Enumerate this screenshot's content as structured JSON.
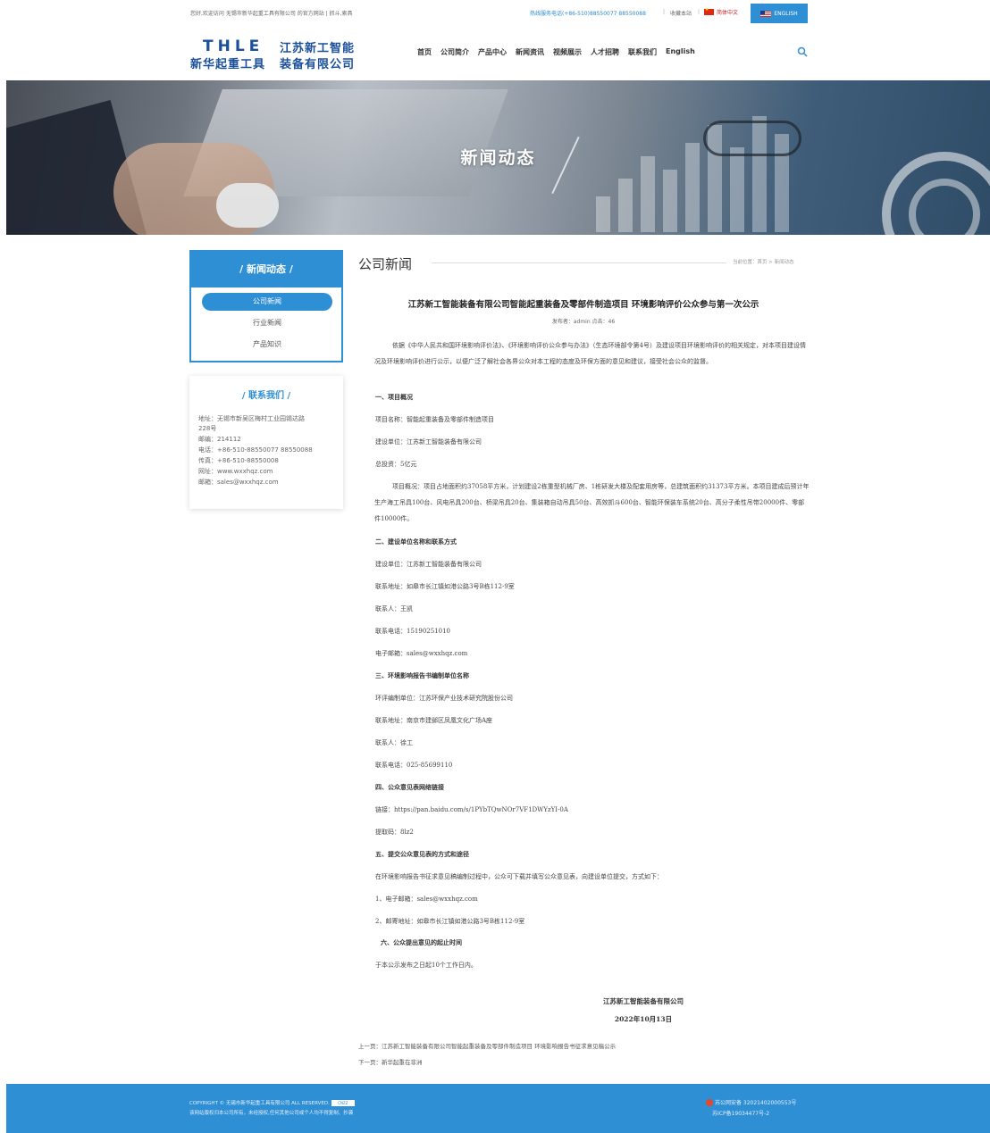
{
  "topbar": {
    "welcome": "您好,欢迎访问 无锡市新华起重工具有限公司 的官方网站  |  抓斗,索具",
    "hotline": "热线服务电话(+86-510)88550077 88550088",
    "bookmark": "收藏本站",
    "lang_cn": "简体中文",
    "lang_en": "ENGLISH"
  },
  "logo": {
    "en": "THLE",
    "cn_left": "新华起重工具",
    "cn_right_1": "江苏新工智能",
    "cn_right_2": "装备有限公司"
  },
  "nav": [
    "首页",
    "公司简介",
    "产品中心",
    "新闻资讯",
    "视频展示",
    "人才招聘",
    "联系我们",
    "English"
  ],
  "banner": {
    "title": "新闻动态"
  },
  "sidebar": {
    "title": "/ 新闻动态 /",
    "items": [
      {
        "label": "公司新闻",
        "active": true
      },
      {
        "label": "行业新闻",
        "active": false
      },
      {
        "label": "产品知识",
        "active": false
      }
    ]
  },
  "contact": {
    "title": "/ 联系我们 /",
    "lines": [
      "地址：无锡市新吴区梅村工业园锡达路",
      "228号",
      "邮编：214112",
      "电话：+86-510-88550077 88550088",
      "传真：+86-510-88550008",
      "网址：www.wxxhqz.com",
      "邮箱：sales@wxxhqz.com"
    ]
  },
  "main": {
    "title": "公司新闻",
    "breadcrumb": "当前位置：首页 > 新闻动态"
  },
  "article": {
    "title": "江苏新工智能装备有限公司智能起重装备及零部件制造项目 环境影响评价公众参与第一次公示",
    "meta": "发布者：admin  点击：46",
    "intro": "依据《中华人民共和国环境影响评价法》、《环境影响评价公众参与办法》（生态环境部令第4号）及建设项目环境影响评价的相关规定，对本项目建设情况及环境影响评价进行公示，以便广泛了解社会各界公众对本工程的态度及环保方面的意见和建议，接受社会公众的监督。",
    "s1_title": "一、项目概况",
    "s1_name": "项目名称：智能起重装备及零部件制造项目",
    "s1_unit": "建设单位：江苏新工智能装备有限公司",
    "s1_invest": "总投资：5亿元",
    "s1_overview": "项目概况：项目占地面积约37058平方米，计划建设2栋重型机械厂房、1栋研发大楼及配套用房等，总建筑面积约31373平方米。本项目建成后预计年生产海工吊具100台、风电吊具200台、桥梁吊具20台、集装箱自动吊具50台、高效抓斗600台、智能环保装车系统20台、高分子柔性吊带20000件、零部件10000件。",
    "s2_title": "二、建设单位名称和联系方式",
    "s2_unit": "建设单位：江苏新工智能装备有限公司",
    "s2_addr": "联系地址：如皋市长江镇如港公路3号B栋112-9室",
    "s2_person": "联系人：王凯",
    "s2_tel": "联系电话：15190251010",
    "s2_mail": "电子邮箱：sales@wxxhqz.com",
    "s3_title": "三、环境影响报告书编制单位名称",
    "s3_unit": "环评编制单位：江苏环保产业技术研究院股份公司",
    "s3_addr": "联系地址：南京市建邺区凤凰文化广场A座",
    "s3_person": "联系人：徐工",
    "s3_tel": "联系电话：025-85699110",
    "s4_title": "四、公众意见表网络链接",
    "s4_link": "链接：https://pan.baidu.com/s/1PYbTQwNOr7VF1DWYzYI-0A",
    "s4_code": "提取码：8lz2",
    "s5_title": "五、提交公众意见表的方式和途径",
    "s5_desc": "在环境影响报告书征求意见稿编制过程中，公众可下载并填写公众意见表，向建设单位提交，方式如下：",
    "s5_m1": "1、电子邮箱：sales@wxxhqz.com",
    "s5_m2": "2、邮寄地址：如皋市长江镇如港公路3号B栋112-9室",
    "s6_title": "六、公众提出意见的起止时间",
    "s6_desc": "于本公示发布之日起10个工作日内。",
    "sign_company": "江苏新工智能装备有限公司",
    "sign_date": "2022年10月13日"
  },
  "prevnext": {
    "prev": "上一页：江苏新工智能装备有限公司智能起重装备及零部件制造项目 环境影响报告书征求意见稿公示",
    "next": "下一页：新华起重在非洲"
  },
  "footer": {
    "copyright": "COPYRIGHT © 无锡市新华起重工具有限公司 ALL RESERVED.",
    "cnzz": "CNZZ",
    "notice": "该网站版权归本公司所有，未经授权,任何其他公司或个人均不得复制、抄袭",
    "police": "苏公网安备 32021402000553号",
    "icp": "苏ICP备19034477号-2"
  },
  "colors": {
    "accent": "#2f8fd5",
    "logo": "#1a4f9c"
  }
}
